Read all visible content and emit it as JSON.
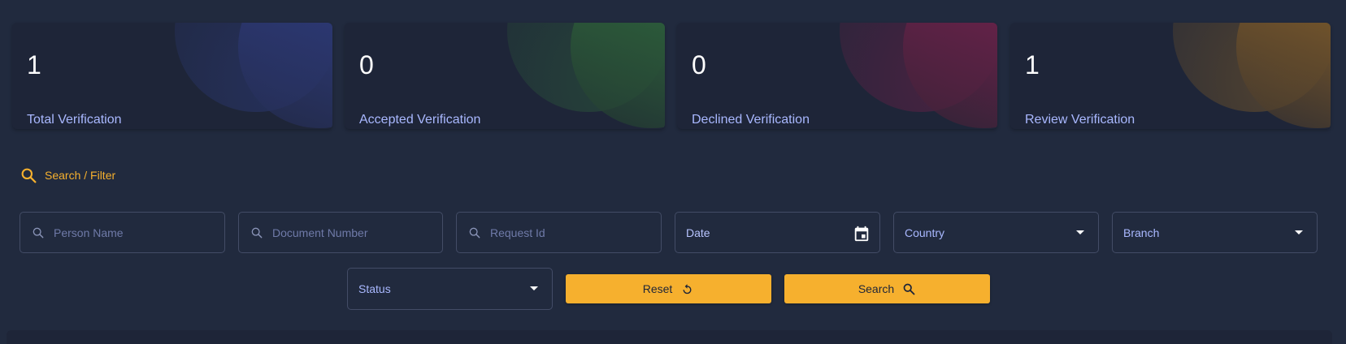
{
  "stats": [
    {
      "value": "1",
      "label": "Total Verification",
      "color": "#2c3a78"
    },
    {
      "value": "0",
      "label": "Accepted Verification",
      "color": "#2c5a3a"
    },
    {
      "value": "0",
      "label": "Declined Verification",
      "color": "#6a2048"
    },
    {
      "value": "1",
      "label": "Review Verification",
      "color": "#7a5a2a"
    }
  ],
  "filter": {
    "title": "Search / Filter",
    "person_name_placeholder": "Person Name",
    "document_number_placeholder": "Document Number",
    "request_id_placeholder": "Request Id",
    "date_label": "Date",
    "country_label": "Country",
    "branch_label": "Branch",
    "status_label": "Status",
    "reset_label": "Reset",
    "search_label": "Search"
  },
  "colors": {
    "accent": "#f6b02e",
    "background": "#212a3e",
    "card": "#1e2538",
    "label": "#a9b8ff"
  },
  "icons": [
    "search-icon",
    "calendar-icon",
    "chevron-down-icon",
    "refresh-icon"
  ]
}
